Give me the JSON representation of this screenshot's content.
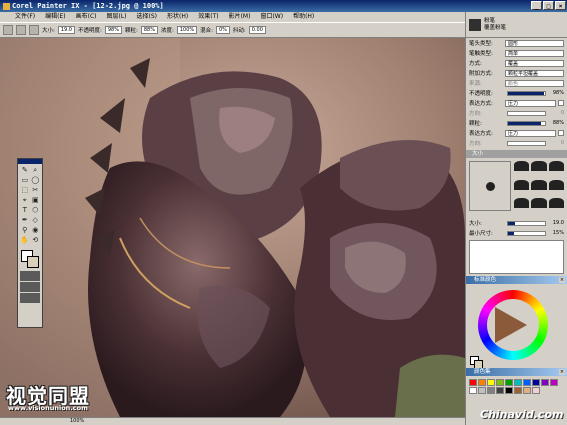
{
  "window": {
    "title": "Corel Painter IX - [12-2.jpg @ 100%]",
    "minimize": "_",
    "maximize": "□",
    "close": "×"
  },
  "menu": [
    "文件(F)",
    "编辑(E)",
    "画布(C)",
    "图层(L)",
    "选择(S)",
    "形状(H)",
    "效果(T)",
    "影片(M)",
    "窗口(W)",
    "帮助(H)"
  ],
  "propbar": {
    "size_label": "大小:",
    "size_value": "19.0",
    "opacity_label": "不透明度:",
    "opacity_value": "98%",
    "grain_label": "颗粒:",
    "grain_value": "88%",
    "resaturation_label": "浓度:",
    "resaturation_value": "100%",
    "bleed_label": "混合:",
    "bleed_value": "0%",
    "jitter_label": "抖动:",
    "jitter_value": "0.00"
  },
  "toolbox": {
    "tools": [
      "✎",
      "⌕",
      "▭",
      "◯",
      "⬚",
      "✂",
      "⌖",
      "▣",
      "T",
      "⬡",
      "✒",
      "◇",
      "⚲",
      "◉",
      "✋",
      "⟲"
    ]
  },
  "brush": {
    "category": "粉笔",
    "variant": "覆盖粉笔"
  },
  "brush_controls": {
    "rows": [
      {
        "label": "笔头类型:",
        "value": "圆形"
      },
      {
        "label": "笔触类型:",
        "value": "简单"
      },
      {
        "label": "方式:",
        "value": "覆盖"
      },
      {
        "label": "附加方式:",
        "value": "颗粒平坦覆盖"
      }
    ],
    "source_label": "来源:",
    "source_value": "颜色",
    "opacity_label": "不透明度:",
    "opacity_value": "98%",
    "opacity_fraction": 0.98,
    "expr1_label": "表达方式:",
    "expr1_value": "压力",
    "dir1_label": "方向:",
    "dir1_value": "0",
    "grain_label": "颗粒:",
    "grain_value": "88%",
    "grain_fraction": 0.88,
    "expr2_label": "表达方式:",
    "expr2_value": "压力",
    "dir2_label": "方向:",
    "dir2_value": "0"
  },
  "size_section": {
    "title": "大小",
    "size_label": "大小:",
    "size_value": "19.0",
    "size_fraction": 0.19,
    "min_label": "最小尺寸:",
    "min_value": "15%",
    "min_fraction": 0.15
  },
  "color_panel": {
    "title": "标准颜色"
  },
  "color_sets": {
    "title": "颜色集",
    "swatches": [
      "#ff0000",
      "#ff8000",
      "#ffff00",
      "#80c000",
      "#00a000",
      "#00c0c0",
      "#0060ff",
      "#0000a0",
      "#8000c0",
      "#c000c0",
      "#ffffff",
      "#c0c0c0",
      "#808080",
      "#404040",
      "#000000",
      "#a06030",
      "#e0b080",
      "#f0d0d0"
    ]
  },
  "status": {
    "zoom": "100%"
  },
  "watermark_logo": "视觉同盟",
  "watermark_url": "www.visionunion.com",
  "watermark_site": "Chinavid.com",
  "colors": {
    "accent": "#0a246a",
    "panel": "#d4d0c8"
  }
}
